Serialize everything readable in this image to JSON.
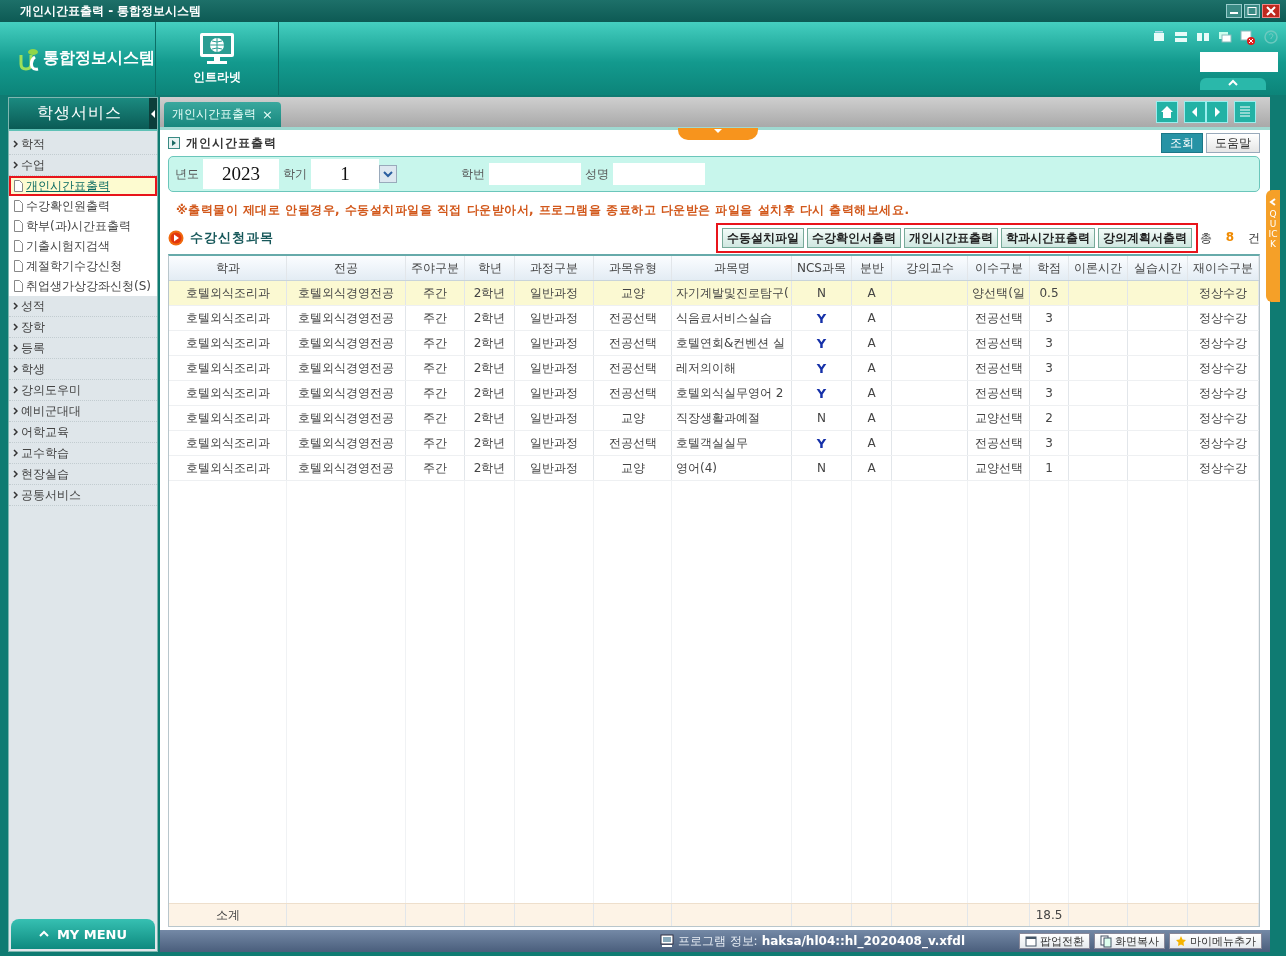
{
  "window": {
    "title": "개인시간표출력 - 통합정보시스템"
  },
  "header": {
    "logo": "통합정보시스템",
    "intranet": "인트라넷"
  },
  "sidebar": {
    "title": "학생서비스",
    "items": [
      {
        "label": "학적"
      },
      {
        "label": "수업",
        "children": [
          {
            "label": "개인시간표출력",
            "selected": true,
            "outlined": true
          },
          {
            "label": "수강확인원출력",
            "selected": false,
            "outlined": false
          },
          {
            "label": "학부(과)시간표출력",
            "selected": false,
            "outlined": false
          },
          {
            "label": "기출시험지검색",
            "selected": false,
            "outlined": false
          },
          {
            "label": "계절학기수강신청",
            "selected": false,
            "outlined": false
          },
          {
            "label": "취업생가상강좌신청(S)",
            "selected": false,
            "outlined": false
          }
        ]
      },
      {
        "label": "성적"
      },
      {
        "label": "장학"
      },
      {
        "label": "등록"
      },
      {
        "label": "학생"
      },
      {
        "label": "강의도우미"
      },
      {
        "label": "예비군대대"
      },
      {
        "label": "어학교육"
      },
      {
        "label": "교수학습"
      },
      {
        "label": "현장실습"
      },
      {
        "label": "공통서비스"
      }
    ],
    "my_menu": "MY MENU"
  },
  "tabs": [
    {
      "label": "개인시간표출력",
      "selected": true,
      "close": "×"
    }
  ],
  "page": {
    "title": "개인시간표출력",
    "buttons": [
      {
        "label": "조회",
        "kind": "primary"
      },
      {
        "label": "도움말",
        "kind": "plain"
      }
    ]
  },
  "search": {
    "fields": [
      {
        "label": "년도",
        "value": "2023",
        "kind": "text"
      },
      {
        "label": "학기",
        "value": "1",
        "kind": "select"
      },
      {
        "label": "학번",
        "kind": "text"
      },
      {
        "label": "성명",
        "kind": "text"
      }
    ]
  },
  "notice": "※출력물이 제대로 안될경우, 수동설치파일을 직접 다운받아서, 프로그램을 종료하고 다운받은 파일을 설치후 다시 출력해보세요.",
  "section": {
    "title": "수강신청과목",
    "actions": {
      "outlined": true,
      "buttons": [
        "수동설치파일",
        "수강확인서출력",
        "개인시간표출력",
        "학과시간표출력",
        "강의계획서출력"
      ]
    },
    "total": {
      "prefix": "총",
      "count": "8",
      "suffix": "건"
    }
  },
  "table": {
    "columns": [
      "학과",
      "전공",
      "주야구분",
      "학년",
      "과정구분",
      "과목유형",
      "과목명",
      "NCS과목",
      "분반",
      "강의교수",
      "이수구분",
      "학점",
      "이론시간",
      "실습시간",
      "재이수구분"
    ],
    "rows": [
      {
        "selected": true,
        "ncs_course": false,
        "cells": [
          "호텔외식조리과",
          "호텔외식경영전공",
          "주간",
          "2학년",
          "일반과정",
          "교양",
          "자기계발및진로탐구(",
          "N",
          "A",
          null,
          "양선택(일",
          "0.5",
          null,
          null,
          "정상수강"
        ]
      },
      {
        "selected": false,
        "ncs_course": true,
        "cells": [
          "호텔외식조리과",
          "호텔외식경영전공",
          "주간",
          "2학년",
          "일반과정",
          "전공선택",
          "식음료서비스실습",
          "Y",
          "A",
          null,
          "전공선택",
          "3",
          null,
          null,
          "정상수강"
        ]
      },
      {
        "selected": false,
        "ncs_course": true,
        "cells": [
          "호텔외식조리과",
          "호텔외식경영전공",
          "주간",
          "2학년",
          "일반과정",
          "전공선택",
          "호텔연회&컨벤션 실",
          "Y",
          "A",
          null,
          "전공선택",
          "3",
          null,
          null,
          "정상수강"
        ]
      },
      {
        "selected": false,
        "ncs_course": true,
        "cells": [
          "호텔외식조리과",
          "호텔외식경영전공",
          "주간",
          "2학년",
          "일반과정",
          "전공선택",
          "레저의이해",
          "Y",
          "A",
          null,
          "전공선택",
          "3",
          null,
          null,
          "정상수강"
        ]
      },
      {
        "selected": false,
        "ncs_course": true,
        "cells": [
          "호텔외식조리과",
          "호텔외식경영전공",
          "주간",
          "2학년",
          "일반과정",
          "전공선택",
          "호텔외식실무영어 2",
          "Y",
          "A",
          null,
          "전공선택",
          "3",
          null,
          null,
          "정상수강"
        ]
      },
      {
        "selected": false,
        "ncs_course": false,
        "cells": [
          "호텔외식조리과",
          "호텔외식경영전공",
          "주간",
          "2학년",
          "일반과정",
          "교양",
          "직장생활과예절",
          "N",
          "A",
          null,
          "교양선택",
          "2",
          null,
          null,
          "정상수강"
        ]
      },
      {
        "selected": false,
        "ncs_course": true,
        "cells": [
          "호텔외식조리과",
          "호텔외식경영전공",
          "주간",
          "2학년",
          "일반과정",
          "전공선택",
          "호텔객실실무",
          "Y",
          "A",
          null,
          "전공선택",
          "3",
          null,
          null,
          "정상수강"
        ]
      },
      {
        "selected": false,
        "ncs_course": false,
        "cells": [
          "호텔외식조리과",
          "호텔외식경영전공",
          "주간",
          "2학년",
          "일반과정",
          "교양",
          "영어(4)",
          "N",
          "A",
          null,
          "교양선택",
          "1",
          null,
          null,
          "정상수강"
        ]
      }
    ],
    "footer": {
      "label": "소계",
      "credits": "18.5"
    }
  },
  "quick": "QUICK",
  "status_bar": {
    "info_label": "프로그램 정보:",
    "info_value": "haksa/hl04::hl_2020408_v.xfdl",
    "buttons": [
      "팝업전환",
      "화면복사",
      "마이메뉴추가"
    ]
  }
}
